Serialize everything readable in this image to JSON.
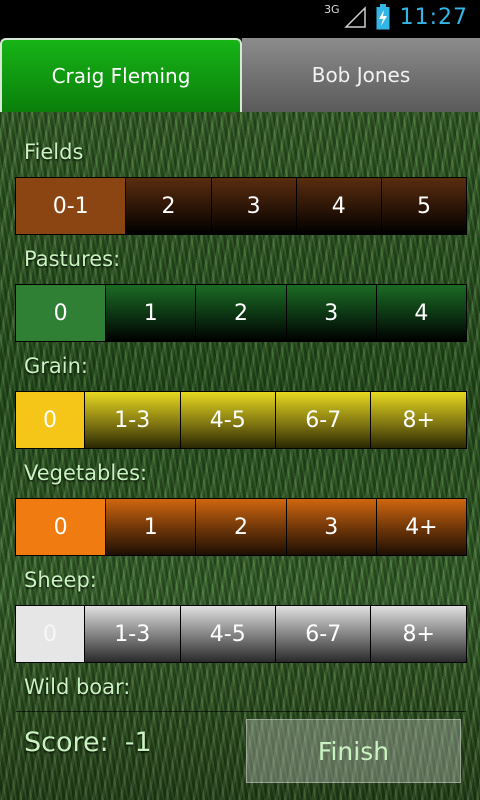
{
  "status_bar": {
    "network": "3G",
    "time": "11:27"
  },
  "tabs": [
    {
      "label": "Craig Fleming",
      "active": true
    },
    {
      "label": "Bob Jones",
      "active": false
    }
  ],
  "sections": {
    "fields": {
      "label": "Fields",
      "options": [
        "0-1",
        "2",
        "3",
        "4",
        "5"
      ],
      "selected": "0-1"
    },
    "pastures": {
      "label": "Pastures:",
      "options": [
        "0",
        "1",
        "2",
        "3",
        "4"
      ],
      "selected": "0"
    },
    "grain": {
      "label": "Grain:",
      "options": [
        "0",
        "1-3",
        "4-5",
        "6-7",
        "8+"
      ],
      "selected": "0"
    },
    "vegetables": {
      "label": "Vegetables:",
      "options": [
        "0",
        "1",
        "2",
        "3",
        "4+"
      ],
      "selected": "0"
    },
    "sheep": {
      "label": "Sheep:",
      "options": [
        "0",
        "1-3",
        "4-5",
        "6-7",
        "8+"
      ],
      "selected": "0"
    },
    "wild_boar": {
      "label": "Wild boar:"
    }
  },
  "score": {
    "label": "Score:",
    "value": "-1"
  },
  "finish_label": "Finish",
  "colors": {
    "status_accent": "#33b5e5",
    "active_tab": "#12a012",
    "label_text": "#c9f3c0"
  }
}
